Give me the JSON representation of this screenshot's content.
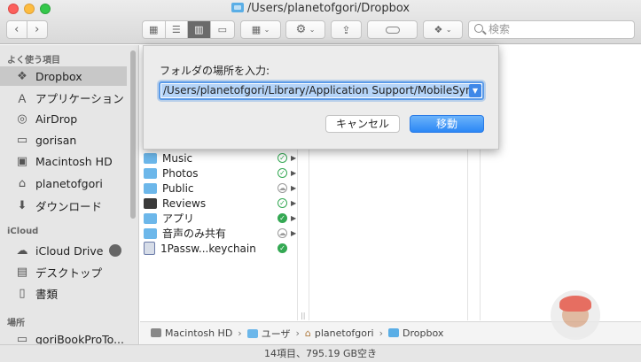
{
  "window": {
    "title": "/Users/planetofgori/Dropbox"
  },
  "toolbar": {
    "search_placeholder": "検索"
  },
  "sidebar": {
    "favorites_heading": "よく使う項目",
    "favorites": [
      {
        "label": "Dropbox",
        "icon": "dropbox-icon",
        "selected": true
      },
      {
        "label": "アプリケーション",
        "icon": "applications-icon"
      },
      {
        "label": "AirDrop",
        "icon": "airdrop-icon"
      },
      {
        "label": "gorisan",
        "icon": "folder-icon"
      },
      {
        "label": "Macintosh HD",
        "icon": "hard-drive-icon"
      },
      {
        "label": "planetofgori",
        "icon": "home-icon"
      },
      {
        "label": "ダウンロード",
        "icon": "downloads-icon"
      }
    ],
    "icloud_heading": "iCloud",
    "icloud": [
      {
        "label": "iCloud Drive",
        "icon": "cloud-icon"
      },
      {
        "label": "デスクトップ",
        "icon": "desktop-icon"
      },
      {
        "label": "書類",
        "icon": "documents-icon"
      }
    ],
    "locations_heading": "場所",
    "locations": [
      {
        "label": "goriBookProTo...",
        "icon": "laptop-icon"
      }
    ]
  },
  "files": [
    {
      "name": "Music",
      "icon": "folder",
      "status": "synced"
    },
    {
      "name": "Photos",
      "icon": "folder",
      "status": "synced"
    },
    {
      "name": "Public",
      "icon": "folder",
      "status": "cloud"
    },
    {
      "name": "Reviews",
      "icon": "folder-dark",
      "status": "synced"
    },
    {
      "name": "アプリ",
      "icon": "folder",
      "status": "synced-filled"
    },
    {
      "name": "音声のみ共有",
      "icon": "folder",
      "status": "cloud"
    },
    {
      "name": "1Passw...keychain",
      "icon": "keychain",
      "status": "synced-filled"
    }
  ],
  "pathbar": {
    "items": [
      "Macintosh HD",
      "ユーザ",
      "planetofgori",
      "Dropbox"
    ],
    "separator": "›"
  },
  "statusbar": {
    "text": "14項目、795.19 GB空き"
  },
  "goto_sheet": {
    "label": "フォルダの場所を入力:",
    "value": "/Users/planetofgori/Library/Application Support/MobileSync/",
    "cancel": "キャンセル",
    "go": "移動"
  },
  "colors": {
    "accent": "#2b87f5",
    "sync_green": "#34a853",
    "folder_blue": "#6cb7ea"
  }
}
